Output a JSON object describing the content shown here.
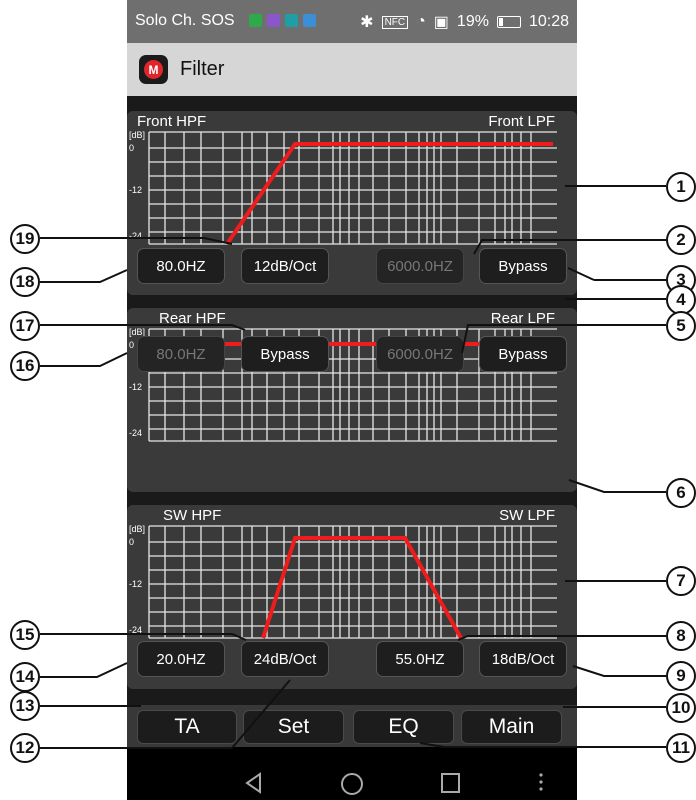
{
  "status_bar": {
    "carrier": "Solo Ch. SOS",
    "battery": "19%",
    "time": "10:28",
    "nfc": "NFC"
  },
  "app": {
    "title": "Filter",
    "logo_letter": "M",
    "accent_color": "#e0262b"
  },
  "graph": {
    "y_ticks": [
      "[dB]",
      "0",
      "-12",
      "-24"
    ],
    "curve_color": "#ee1c1c"
  },
  "front": {
    "hpf_label": "Front HPF",
    "lpf_label": "Front LPF",
    "hpf_freq": "80.0HZ",
    "hpf_slope": "12dB/Oct",
    "lpf_freq": "6000.0HZ",
    "lpf_slope": "Bypass"
  },
  "rear": {
    "hpf_label": "Rear HPF",
    "lpf_label": "Rear LPF",
    "hpf_freq": "80.0HZ",
    "hpf_slope": "Bypass",
    "lpf_freq": "6000.0HZ",
    "lpf_slope": "Bypass"
  },
  "sw": {
    "hpf_label": "SW HPF",
    "lpf_label": "SW LPF",
    "hpf_freq": "20.0HZ",
    "hpf_slope": "24dB/Oct",
    "lpf_freq": "55.0HZ",
    "lpf_slope": "18dB/Oct"
  },
  "nav": {
    "ta": "TA",
    "set": "Set",
    "eq": "EQ",
    "main": "Main"
  },
  "system_nav": [
    "back-icon",
    "home-icon",
    "recents-icon",
    "menu-icon"
  ],
  "callouts": [
    "1",
    "2",
    "3",
    "4",
    "5",
    "6",
    "7",
    "8",
    "9",
    "10",
    "11",
    "12",
    "13",
    "14",
    "15",
    "16",
    "17",
    "18",
    "19"
  ]
}
